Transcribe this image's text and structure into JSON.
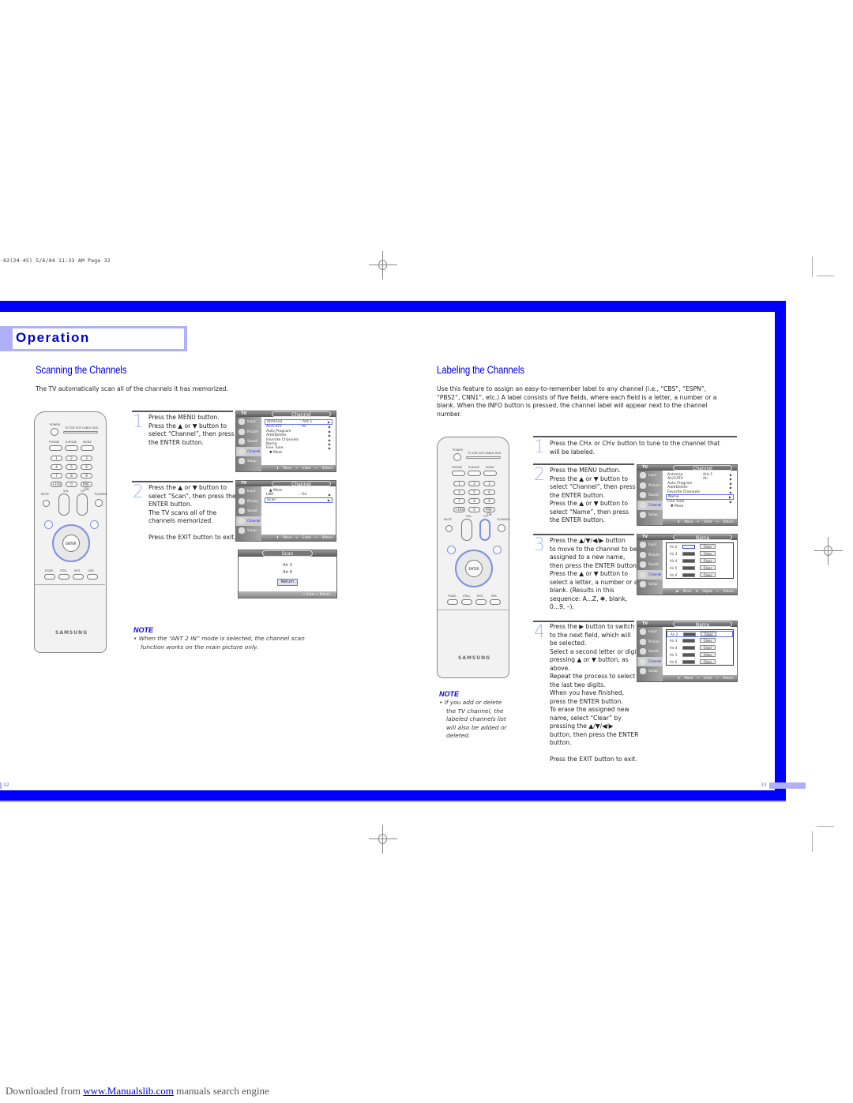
{
  "print_slug": "-02(24-45)  5/6/04  11:33 AM  Page 32",
  "section_tab": "Operation",
  "left_page": {
    "heading": "Scanning the Channels",
    "intro": "The TV automatically scan all of the channels it has memorized.",
    "steps": [
      {
        "number": "1",
        "lines": [
          "Press the MENU button.",
          "Press the ▲ or ▼ button to",
          "select “Channel”, then press",
          "the ENTER button."
        ]
      },
      {
        "number": "2",
        "lines": [
          "Press the ▲ or ▼ button to",
          "select “Scan”, then press the",
          "ENTER button.",
          "The TV scans all of the",
          "channels memorized.",
          "",
          "Press the EXIT button to exit."
        ]
      }
    ],
    "note_title": "NOTE",
    "note_lines": [
      "When the “ANT 2 IN” mode is selected, the channel scan",
      "function works on the main picture only."
    ],
    "page_number": "32"
  },
  "right_page": {
    "heading": "Labeling the Channels",
    "intro_lines": [
      "Use this feature to assign an easy-to-remember label to any channel (i.e., “CBS”, “ESPN”,",
      "“PBS2”, CNN1”, etc.) A label consists of five fields, where each field is a letter, a number or a",
      "blank. When the INFO button is pressed, the channel label will appear next to the channel",
      "number."
    ],
    "steps": [
      {
        "number": "1",
        "lines": [
          "Press the CH∧ or CH∨ button to tune to the channel that",
          "will be labeled."
        ]
      },
      {
        "number": "2",
        "lines": [
          "Press the MENU button.",
          "Press the ▲ or ▼ button to",
          "select “Channel”, then press",
          "the ENTER button.",
          "Press the ▲ or ▼ button to",
          "select “Name”, then press",
          "the ENTER button."
        ]
      },
      {
        "number": "3",
        "lines": [
          "Press the ▲/▼/◀/▶ button",
          "to move to the channel to be",
          "assigned to a new name,",
          "then press the ENTER button.",
          "Press the ▲ or ▼ button to",
          "select a letter, a number or a",
          "blank. (Results in this",
          "sequence: A...Z, ✱, blank,",
          "0...9, –)."
        ]
      },
      {
        "number": "4",
        "lines": [
          "Press the ▶ button to switch",
          "to the next field, which will",
          "be selected.",
          "Select a second letter or digit",
          "pressing ▲ or ▼ button, as",
          "above.",
          "Repeat the process to select",
          "the last two digits.",
          "When you have finished,",
          "press the ENTER button.",
          "To erase the assigned new",
          "name, select “Clear” by",
          "pressing the ▲/▼/◀/▶",
          "button, then press the ENTER",
          "button.",
          "",
          "Press the EXIT button to exit."
        ]
      }
    ],
    "note_title": "NOTE",
    "note_lines": [
      "If you add or delete",
      "the TV channel, the",
      "labeled channels list",
      "will also be added or",
      "deleted."
    ],
    "page_number": "33"
  },
  "osd": {
    "tv_label": "TV",
    "sidebar": [
      "Input",
      "Picture",
      "Sound",
      "Channel",
      "Setup"
    ],
    "selected_sidebar": "Channel",
    "channel_menu": {
      "title": "Channel",
      "rows": [
        {
          "label": "Antenna",
          "value": ": Ant.1"
        },
        {
          "label": "Air/CATV",
          "value": ": Air"
        },
        {
          "label": "Auto Program",
          "value": ""
        },
        {
          "label": "Add/Delete",
          "value": ""
        },
        {
          "label": "Favorite Channels",
          "value": ""
        },
        {
          "label": "Name",
          "value": ""
        },
        {
          "label": "Fine Tune",
          "value": ""
        },
        {
          "label": "▼ More",
          "value": ""
        }
      ],
      "footer": "⬍ Move  ↵ Enter  ↩ Return"
    },
    "channel_menu_2": {
      "title": "Channel",
      "rows": [
        {
          "label": "▲ More",
          "value": ""
        },
        {
          "label": "LNA",
          "value": ": On"
        },
        {
          "label": "Scan",
          "value": ""
        }
      ],
      "footer": "⬍ Move  ↵ Enter  ↩ Return"
    },
    "scan_dialog": {
      "title": "Scan",
      "channels": [
        "Air 3",
        "Air 4"
      ],
      "button": "Return",
      "footer": "↵ Enter    ↩ Return"
    },
    "name_menu": {
      "title": "Name",
      "rows": [
        {
          "channel": "Air  2",
          "clear": "Clear"
        },
        {
          "channel": "Air  3",
          "clear": "Clear"
        },
        {
          "channel": "Air  4",
          "clear": "Clear"
        },
        {
          "channel": "Air  5",
          "clear": "Clear"
        },
        {
          "channel": "Air  6",
          "clear": "Clear"
        }
      ],
      "footer_adjust": "▶ Move  ⬍ Adjust  ↩ Return",
      "footer_enter": "⬍ Move  ↵ Enter  ↩ Return"
    }
  },
  "remote": {
    "power": "POWER",
    "source_labels": "TV  STB  VCR  CABLE  DVD",
    "mode_buttons": [
      "P.MODE",
      "S.MODE",
      "MODE"
    ],
    "number_keys": [
      "1",
      "2",
      "3",
      "4",
      "5",
      "6",
      "7",
      "8",
      "9",
      "+100",
      "0",
      "PRE-CH"
    ],
    "vol": "VOL",
    "ch": "CH",
    "mute": "MUTE",
    "tv_video": "TV/VIDEO",
    "enter": "ENTER",
    "bottom_keys": [
      "P.SIZE",
      "STILL",
      "MTS",
      "SRS"
    ],
    "brand": "SAMSUNG"
  },
  "footer": {
    "prefix": "Downloaded from ",
    "link": "www.Manualslib.com",
    "suffix": " manuals search engine"
  }
}
